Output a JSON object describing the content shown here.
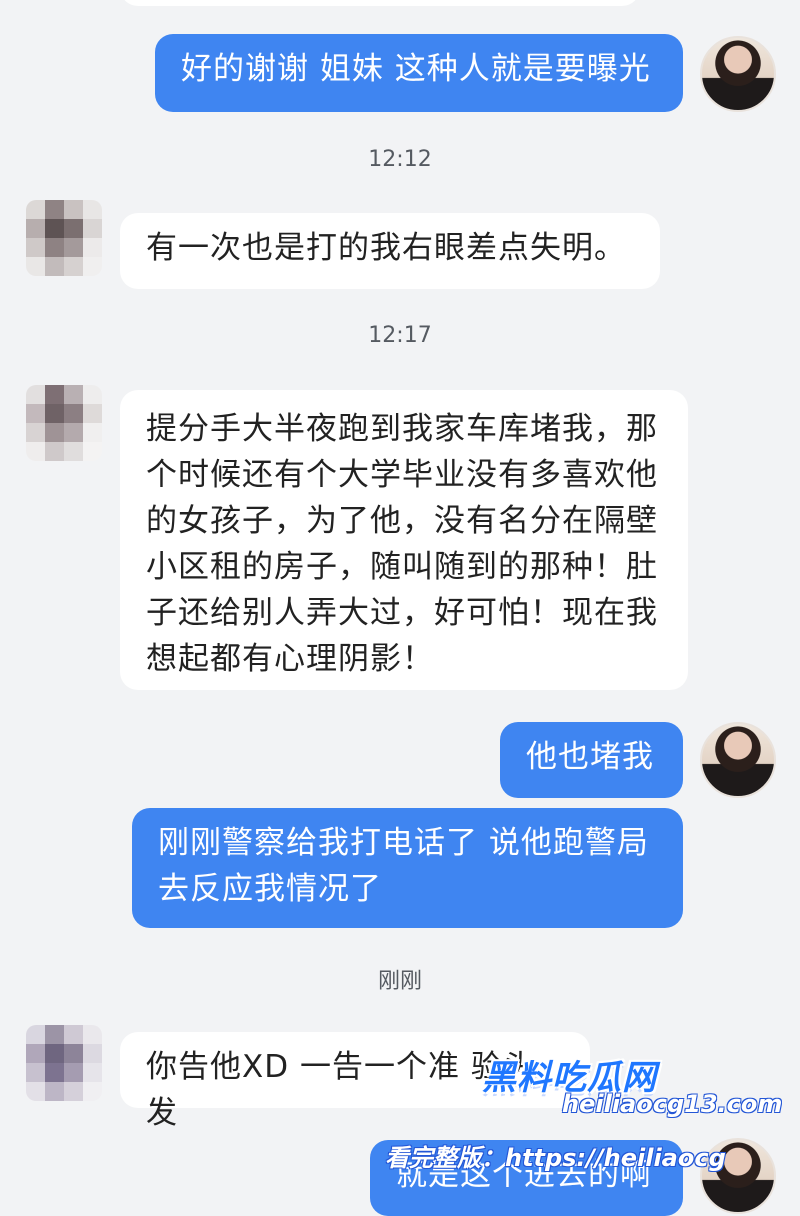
{
  "messages": [
    {
      "text": "好的谢谢 姐妹 这种人就是要曝光"
    },
    {
      "text": "有一次也是打的我右眼差点失明。"
    },
    {
      "text": "提分手大半夜跑到我家车库堵我，那个时候还有个大学毕业没有多喜欢他的女孩子，为了他，没有名分在隔壁小区租的房子，随叫随到的那种！肚子还给别人弄大过，好可怕！现在我想起都有心理阴影！"
    },
    {
      "text": "他也堵我"
    },
    {
      "text": "刚刚警察给我打电话了 说他跑警局去反应我情况了"
    },
    {
      "text": "你告他XD 一告一个准 验头发"
    },
    {
      "text": "就是这个进去的啊"
    }
  ],
  "timestamps": [
    "12:12",
    "12:17",
    "刚刚"
  ],
  "watermark": {
    "logo": "黑料吃瓜网",
    "url_line_1": "heiliaocg13.com",
    "url_line_2": "看完整版：https://heiliaocg"
  },
  "colors": {
    "outgoing_bubble": "#3f85f1",
    "incoming_bubble": "#ffffff",
    "background": "#f2f3f5"
  }
}
